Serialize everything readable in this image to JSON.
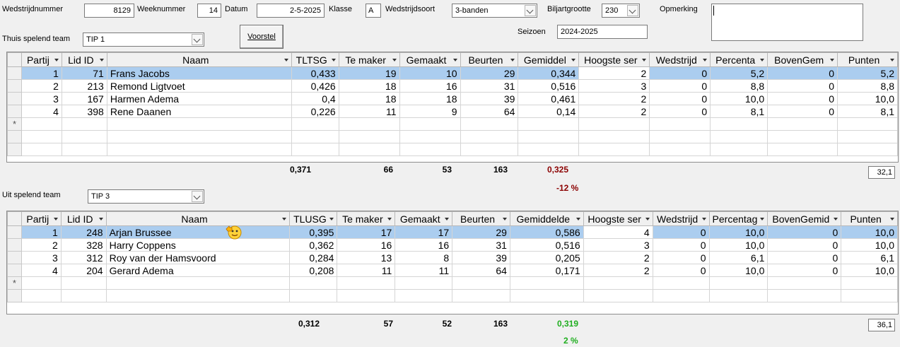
{
  "header": {
    "wedstrijdnummer_label": "Wedstrijdnummer",
    "wedstrijdnummer": "8129",
    "weeknummer_label": "Weeknummer",
    "weeknummer": "14",
    "datum_label": "Datum",
    "datum": "2-5-2025",
    "klasse_label": "Klasse",
    "klasse": "A",
    "wedstrijdsoort_label": "Wedstrijdsoort",
    "wedstrijdsoort": "3-banden",
    "biljartgrootte_label": "Biljartgrootte",
    "biljartgrootte": "230",
    "opmerking_label": "Opmerking",
    "opmerking": "",
    "seizoen_label": "Seizoen",
    "seizoen": "2024-2025",
    "thuis_label": "Thuis spelend team",
    "thuis_team": "TIP 1",
    "voorstel_button": "Voorstel",
    "uit_label": "Uit spelend team",
    "uit_team": "TIP 3"
  },
  "home_grid": {
    "columns": [
      "Partij",
      "Lid ID",
      "Naam",
      "TLTSG",
      "Te maker",
      "Gemaakt",
      "Beurten",
      "Gemiddel",
      "Hoogste ser",
      "Wedstrijd",
      "Percenta",
      "BovenGem",
      "Punten"
    ],
    "rows": [
      [
        "1",
        "71",
        "Frans Jacobs",
        "0,433",
        "19",
        "10",
        "29",
        "0,344",
        "2",
        "0",
        "5,2",
        "0",
        "5,2"
      ],
      [
        "2",
        "213",
        "Remond Ligtvoet",
        "0,426",
        "18",
        "16",
        "31",
        "0,516",
        "3",
        "0",
        "8,8",
        "0",
        "8,8"
      ],
      [
        "3",
        "167",
        "Harmen Adema",
        "0,4",
        "18",
        "18",
        "39",
        "0,461",
        "2",
        "0",
        "10,0",
        "0",
        "10,0"
      ],
      [
        "4",
        "398",
        "Rene Daanen",
        "0,226",
        "11",
        "9",
        "64",
        "0,14",
        "2",
        "0",
        "8,1",
        "0",
        "8,1"
      ]
    ],
    "new_row_marker": "*",
    "totals": {
      "tsg": "0,371",
      "te_maken": "66",
      "gemaakt": "53",
      "beurten": "163",
      "gemiddelde": "0,325",
      "punten": "32,1"
    },
    "percentage": "-12 %"
  },
  "away_grid": {
    "columns": [
      "Partij",
      "Lid ID",
      "Naam",
      "TLUSG",
      "Te maker",
      "Gemaakt",
      "Beurten",
      "Gemiddelde",
      "Hoogste ser",
      "Wedstrijd",
      "Percentag",
      "BovenGemid",
      "Punten"
    ],
    "rows": [
      [
        "1",
        "248",
        "Arjan Brussee",
        "0,395",
        "17",
        "17",
        "29",
        "0,586",
        "4",
        "0",
        "10,0",
        "0",
        "10,0"
      ],
      [
        "2",
        "328",
        "Harry Coppens",
        "0,362",
        "16",
        "16",
        "31",
        "0,516",
        "3",
        "0",
        "10,0",
        "0",
        "10,0"
      ],
      [
        "3",
        "312",
        "Roy van der Hamsvoord",
        "0,284",
        "13",
        "8",
        "39",
        "0,205",
        "2",
        "0",
        "6,1",
        "0",
        "6,1"
      ],
      [
        "4",
        "204",
        "Gerard Adema",
        "0,208",
        "11",
        "11",
        "64",
        "0,171",
        "2",
        "0",
        "10,0",
        "0",
        "10,0"
      ]
    ],
    "new_row_marker": "*",
    "totals": {
      "tsg": "0,312",
      "te_maken": "57",
      "gemaakt": "52",
      "beurten": "163",
      "gemiddelde": "0,319",
      "punten": "36,1"
    },
    "percentage": "2 %"
  },
  "colors": {
    "negative": "#8b0000",
    "positive": "#1fae1f",
    "selected_row": "#abcdef"
  },
  "icons": {
    "thumbs_up": "thumbs-up-emoji-icon"
  }
}
